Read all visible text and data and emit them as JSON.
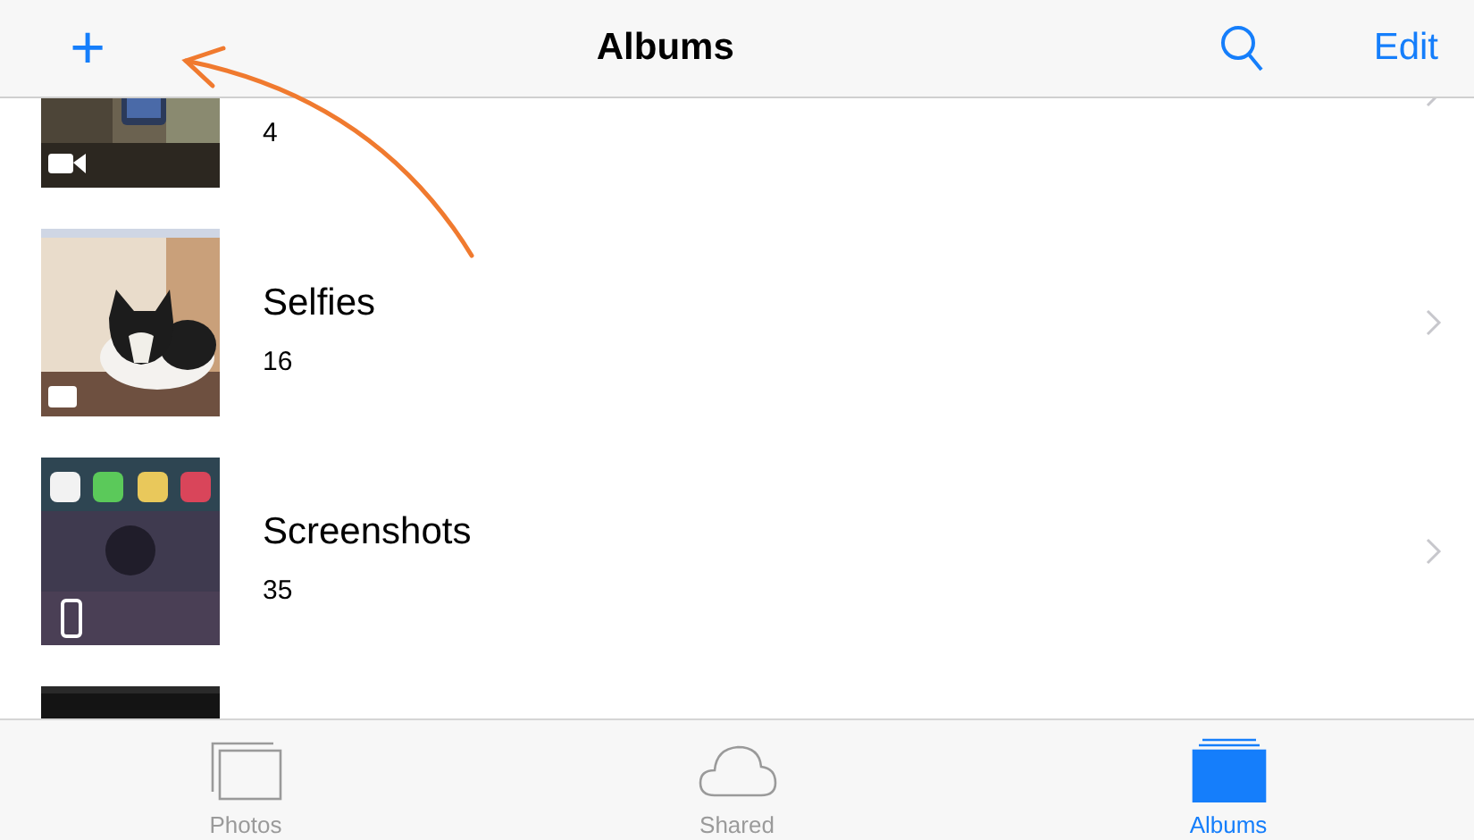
{
  "nav_bar": {
    "add_button": "+",
    "title": "Albums",
    "edit_button": "Edit"
  },
  "albums": [
    {
      "count": "4",
      "kind": "picture"
    },
    {
      "title": "Selfies",
      "count": "16",
      "kind": "picture"
    },
    {
      "title": "Screenshots",
      "count": "35",
      "kind": "picture"
    },
    {
      "kind": "picture"
    }
  ],
  "tab_bar": [
    {
      "kind": "photos",
      "label": "Photos",
      "selected": false
    },
    {
      "kind": "shared",
      "label": "Shared",
      "selected": false
    },
    {
      "kind": "albums",
      "label": "Albums",
      "selected": true
    }
  ]
}
